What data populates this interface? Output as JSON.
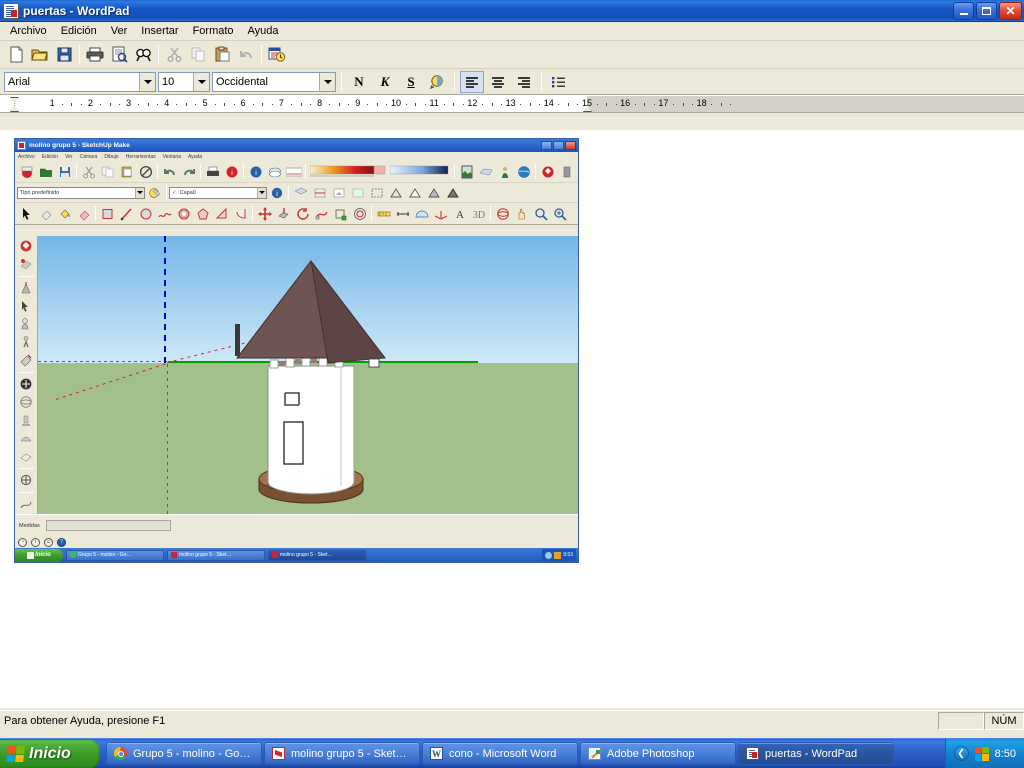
{
  "window": {
    "title": "puertas - WordPad",
    "icon": "wordpad-icon",
    "minimize_label": "Minimizar",
    "maximize_label": "Restaurar",
    "close_label": "Cerrar"
  },
  "menubar": {
    "items": [
      {
        "label": "Archivo"
      },
      {
        "label": "Edición"
      },
      {
        "label": "Ver"
      },
      {
        "label": "Insertar"
      },
      {
        "label": "Formato"
      },
      {
        "label": "Ayuda"
      }
    ]
  },
  "toolbar": {
    "buttons": [
      {
        "name": "new-icon",
        "label": "Nuevo"
      },
      {
        "name": "open-icon",
        "label": "Abrir"
      },
      {
        "name": "save-icon",
        "label": "Guardar"
      },
      {
        "name": "print-icon",
        "label": "Imprimir"
      },
      {
        "name": "print-preview-icon",
        "label": "Vista previa de impresión"
      },
      {
        "name": "find-icon",
        "label": "Buscar"
      },
      {
        "name": "cut-icon",
        "label": "Cortar"
      },
      {
        "name": "copy-icon",
        "label": "Copiar"
      },
      {
        "name": "paste-icon",
        "label": "Pegar"
      },
      {
        "name": "undo-icon",
        "label": "Deshacer"
      },
      {
        "name": "date-time-icon",
        "label": "Fecha y hora"
      }
    ]
  },
  "formatbar": {
    "font_family": "Arial",
    "font_size": "10",
    "script": "Occidental",
    "buttons": [
      {
        "name": "bold-button",
        "glyph": "N",
        "label": "Negrita",
        "selected": false
      },
      {
        "name": "italic-button",
        "glyph": "K",
        "label": "Cursiva",
        "selected": false
      },
      {
        "name": "underline-button",
        "glyph": "S",
        "label": "Subrayado",
        "selected": false
      },
      {
        "name": "font-color-button",
        "glyph": "◉",
        "label": "Color",
        "selected": false
      },
      {
        "name": "align-left-button",
        "glyph": "≡",
        "label": "Alinear a la izquierda",
        "selected": true
      },
      {
        "name": "align-center-button",
        "glyph": "≡",
        "label": "Centrar",
        "selected": false
      },
      {
        "name": "align-right-button",
        "glyph": "≡",
        "label": "Alinear a la derecha",
        "selected": false
      },
      {
        "name": "bullets-button",
        "glyph": "•",
        "label": "Viñetas",
        "selected": false
      }
    ]
  },
  "ruler": {
    "numbers": [
      1,
      2,
      3,
      4,
      5,
      6,
      7,
      8,
      9,
      10,
      11,
      12,
      13,
      14,
      15,
      16,
      17,
      18
    ],
    "right_margin_at": 15,
    "unit": "cm"
  },
  "statusbar": {
    "help_text": "Para obtener Ayuda, presione F1",
    "caps": "",
    "num": "NÚM"
  },
  "embedded_image": {
    "name": "sketchup-screenshot",
    "window": {
      "title": "molino grupo 5 - SketchUp Make",
      "icon": "sketchup-icon"
    },
    "menubar": [
      "Archivo",
      "Edición",
      "Ver",
      "Cámara",
      "Dibujo",
      "Herramientas",
      "Ventana",
      "Ayuda"
    ],
    "toolbar_rows": [
      [
        "nuevo",
        "abrir",
        "guardar",
        "cortar",
        "copiar",
        "pegar",
        "borrar",
        "deshacer",
        "rehacer",
        "imprimir",
        "info-modelo",
        "capas",
        "estilos",
        "sombras",
        "niebla",
        "escenas",
        "componentes",
        "materiales",
        "geolocalizacion",
        "almacen"
      ],
      [
        "tipo-predefinido",
        "capa-actual"
      ],
      [
        "seleccionar",
        "pintar",
        "borrar",
        "rectangulo",
        "linea",
        "circulo",
        "arco",
        "polígono",
        "mano-alzada",
        "mover",
        "empujar-tirar",
        "rotar",
        "sígueme",
        "escala",
        "equidistancia",
        "medir",
        "acotar",
        "transportador",
        "texto",
        "ejes",
        "texto3d",
        "orbitar",
        "desplazar",
        "zoom",
        "zoom-ventana"
      ]
    ],
    "dropdowns": {
      "style": "Tipo predefinido",
      "layer": "Capa0"
    },
    "measurements_label": "Medidas",
    "measurements_value": "",
    "model": {
      "name": "molino-tower",
      "description": "Torre cilíndrica blanca con tejado cónico marrón y base de piedra",
      "sky_color": "#74b6e8",
      "ground_color": "#a3c08a",
      "roof_color": "#6b4f4f",
      "body_color": "#ffffff",
      "base_color": "#9c6b43"
    },
    "taskbar": {
      "start": "Inicio",
      "items": [
        {
          "label": "Grupo 5 - molino - Go…",
          "icon": "chrome-icon",
          "active": false
        },
        {
          "label": "molino grupo 5 - Sket…",
          "icon": "sketchup-icon",
          "active": false
        },
        {
          "label": "molino grupo 5 - Sket…",
          "icon": "sketchup-icon",
          "active": true
        }
      ],
      "clock": "9:53"
    }
  },
  "taskbar": {
    "start_label": "Inicio",
    "items": [
      {
        "label": "Grupo 5 - molino - Go…",
        "icon": "chrome-icon",
        "active": false
      },
      {
        "label": "molino grupo 5 - Sket…",
        "icon": "sketchup-icon",
        "active": false
      },
      {
        "label": "cono - Microsoft Word",
        "icon": "word-icon",
        "active": false
      },
      {
        "label": "Adobe Photoshop",
        "icon": "photoshop-icon",
        "active": false
      },
      {
        "label": "puertas - WordPad",
        "icon": "wordpad-icon",
        "active": true
      }
    ],
    "tray": {
      "show_hidden_label": "❮",
      "icons": [
        "network-icon"
      ],
      "clock": "8:50"
    }
  },
  "colors": {
    "title_blue": "#1452bd",
    "face_beige": "#ece9d8",
    "taskbar_blue": "#2f63cb",
    "start_green": "#389a27",
    "doc_white": "#ffffff"
  }
}
